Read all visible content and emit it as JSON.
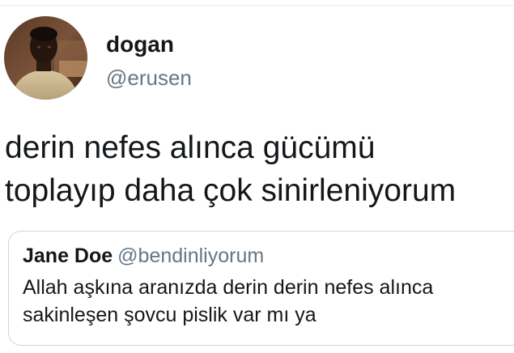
{
  "tweet": {
    "author": {
      "name": "dogan",
      "handle": "@erusen"
    },
    "text_lines": [
      "derin nefes alınca gücümü",
      "toplayıp daha çok sinirleniyorum"
    ]
  },
  "quoted_tweet": {
    "author": {
      "name": "Jane Doe",
      "handle": "@bendinliyorum"
    },
    "text_lines": [
      "Allah aşkına aranızda derin derin nefes alınca",
      "sakinleşen şovcu pislik var mı ya"
    ]
  },
  "colors": {
    "text_primary": "#14171a",
    "text_secondary": "#657786",
    "border": "#ccd6dd"
  }
}
